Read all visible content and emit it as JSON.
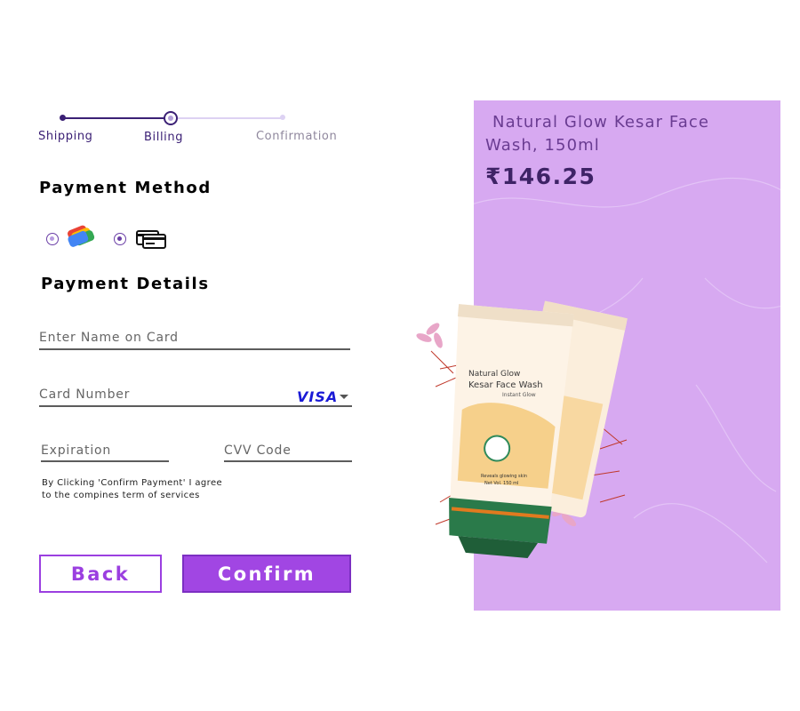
{
  "stepper": {
    "steps": [
      {
        "label": "Shipping",
        "state": "done"
      },
      {
        "label": "Billing",
        "state": "current"
      },
      {
        "label": "Confirmation",
        "state": "upcoming"
      }
    ]
  },
  "payment_method": {
    "title": "Payment Method",
    "options": [
      {
        "icon": "google-pay-icon",
        "selected": false
      },
      {
        "icon": "credit-card-icon",
        "selected": true
      }
    ]
  },
  "payment_details": {
    "title": "Payment Details",
    "name_placeholder": "Enter Name on Card",
    "card_number_placeholder": "Card Number",
    "card_brand": "VISA",
    "expiration_placeholder": "Expiration",
    "cvv_placeholder": "CVV Code",
    "terms": "By Clicking 'Confirm Payment' I agree to the compines term of services"
  },
  "buttons": {
    "back": "Back",
    "confirm": "Confirm"
  },
  "product": {
    "name": "Natural Glow Kesar Face Wash, 150ml",
    "price": "₹146.25",
    "tube_brand_line1": "Natural Glow",
    "tube_brand_line2": "Kesar Face Wash",
    "tube_tagline": "Instant Glow",
    "tube_claim": "Reveals glowing skin",
    "tube_volume": "Net Vol. 150 ml"
  },
  "colors": {
    "accent": "#a146e3",
    "panel_bg": "#d7a9f1",
    "stepper": "#3b2075",
    "visa": "#1a1ad6"
  }
}
